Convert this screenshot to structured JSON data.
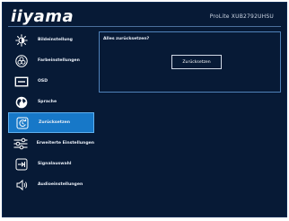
{
  "header": {
    "brand": "iiyama",
    "model": "ProLite XUB2792UHSU"
  },
  "menu": {
    "items": [
      {
        "label": "Bildeinstellung",
        "icon": "brightness-icon"
      },
      {
        "label": "Farbeinstellungen",
        "icon": "color-icon"
      },
      {
        "label": "OSD",
        "icon": "osd-icon"
      },
      {
        "label": "Sprache",
        "icon": "globe-icon"
      },
      {
        "label": "Zurücksetzen",
        "icon": "reset-icon",
        "active": true
      },
      {
        "label": "Erweiterte Einstellungen",
        "icon": "advanced-settings-icon"
      },
      {
        "label": "Signalauswahl",
        "icon": "input-icon"
      },
      {
        "label": "Audioeinstellungen",
        "icon": "speaker-icon"
      }
    ]
  },
  "panel": {
    "title": "Alles zurücksetzen?",
    "button_label": "Zurücksetzen"
  },
  "colors": {
    "background": "#071a36",
    "accent": "#1778c8"
  }
}
